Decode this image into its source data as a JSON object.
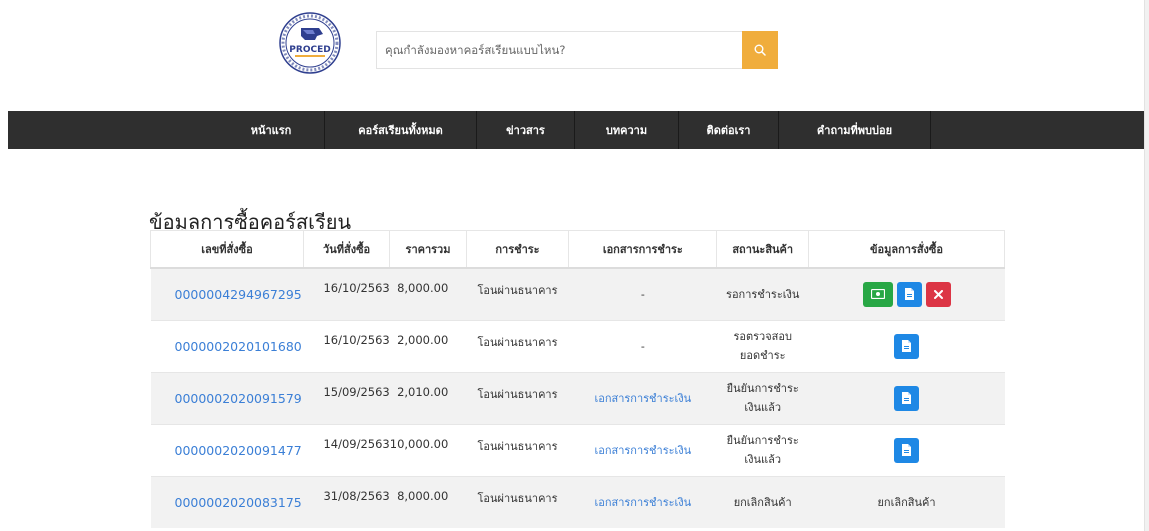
{
  "header": {
    "search": {
      "placeholder": "คุณกำลังมองหาคอร์สเรียนแบบไหน?"
    },
    "logo_text": "PROCED",
    "accent_color": "#f0ad3c"
  },
  "nav": {
    "items": [
      "หน้าแรก",
      "คอร์สเรียนทั้งหมด",
      "ข่าวสาร",
      "บทความ",
      "ติดต่อเรา",
      "คำถามที่พบบ่อย"
    ]
  },
  "page": {
    "title": "ข้อมูลการซื้อคอร์สเรียน"
  },
  "table": {
    "headers": [
      "เลขที่สั่งซื้อ",
      "วันที่สั่งซื้อ",
      "ราคารวม",
      "การชำระ",
      "เอกสารการชำระ",
      "สถานะสินค้า",
      "ข้อมูลการสั่งซื้อ"
    ],
    "rows": [
      {
        "order_id": "0000004294967295",
        "date": "16/10/2563",
        "total": "8,000.00",
        "payment": "โอนผ่านธนาคาร",
        "document": "-",
        "status": "รอการชำระเงิน",
        "status2": "",
        "info": ""
      },
      {
        "order_id": "0000002020101680",
        "date": "16/10/2563",
        "total": "2,000.00",
        "payment": "โอนผ่านธนาคาร",
        "document": "-",
        "status": "รอตรวจสอบ",
        "status2": "ยอดชำระ",
        "info": ""
      },
      {
        "order_id": "0000002020091579",
        "date": "15/09/2563",
        "total": "2,010.00",
        "payment": "โอนผ่านธนาคาร",
        "document": "เอกสารการชำระเงิน",
        "status": "ยืนยันการชำระ",
        "status2": "เงินแล้ว",
        "info": ""
      },
      {
        "order_id": "0000002020091477",
        "date": "14/09/2563",
        "total": "10,000.00",
        "payment": "โอนผ่านธนาคาร",
        "document": "เอกสารการชำระเงิน",
        "status": "ยืนยันการชำระ",
        "status2": "เงินแล้ว",
        "info": ""
      },
      {
        "order_id": "0000002020083175",
        "date": "31/08/2563",
        "total": "8,000.00",
        "payment": "โอนผ่านธนาคาร",
        "document": "เอกสารการชำระเงิน",
        "status": "ยกเลิกสินค้า",
        "status2": "",
        "info": "ยกเลิกสินค้า"
      }
    ],
    "action_icons": {
      "pay": "money-icon",
      "detail": "document-icon",
      "cancel": "close-icon"
    },
    "action_colors": {
      "pay": "#28a745",
      "detail": "#1e88e5",
      "cancel": "#dc3545"
    }
  }
}
